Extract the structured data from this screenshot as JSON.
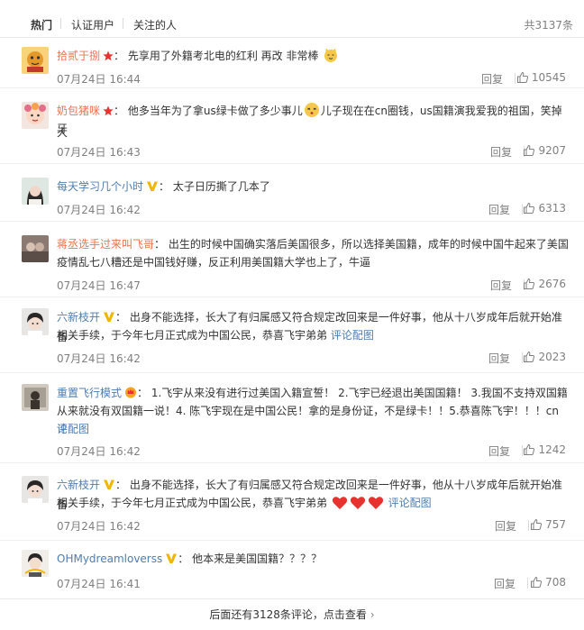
{
  "tabs": {
    "hot": "热门",
    "verified": "认证用户",
    "following": "关注的人",
    "total": "共3137条"
  },
  "comments": [
    {
      "username": "拾贰于捌",
      "badge": "star",
      "colon": "：",
      "text": "先享用了外籍考北电的红利 再改 非常棒",
      "emoji": "cat-face",
      "time": "07月24日 16:44",
      "reply": "回复",
      "likes": "10545"
    },
    {
      "username": "奶包猪咪",
      "badge": "star",
      "colon": "：",
      "text_a": "他多当年为了拿us绿卡做了多少事儿",
      "emoji": "dizzy-face",
      "text_b": "儿子现在在cn圈钱，us国籍演我爱我的祖国，笑掉大",
      "text_c": "牙",
      "time": "07月24日 16:43",
      "reply": "回复",
      "likes": "9207"
    },
    {
      "username": "每天学习几个小时",
      "badge": "v-yellow",
      "colon": "：",
      "text": "太子日历撕了几本了",
      "time": "07月24日 16:42",
      "reply": "回复",
      "likes": "6313"
    },
    {
      "username": "蒋丞选手过来叫飞哥",
      "colon": "：",
      "text_a": "出生的时候中国确实落后美国很多，所以选择美国籍，成年的时候中国牛起来了美国",
      "text_b": "疫情乱七八糟还是中国钱好赚，反正利用美国籍大学也上了，牛逼",
      "time": "07月24日 16:47",
      "reply": "回复",
      "likes": "2676"
    },
    {
      "username": "六新枝开",
      "badge": "v-yellow",
      "colon": "：",
      "text_a": "出身不能选择，长大了有归属感又符合规定改回来是一件好事，他从十八岁成年后就开始准备",
      "text_b": "相关手续，于今年七月正式成为中国公民，恭喜飞宇弟弟",
      "link": "评论配图",
      "time": "07月24日 16:42",
      "reply": "回复",
      "likes": "2023"
    },
    {
      "username": "重置飞行模式",
      "badge": "crown",
      "colon": "：",
      "text_a": "1.飞宇从来没有进行过美国入籍宣誓！ 2.飞宇已经退出美国国籍！ 3.我国不支持双国籍",
      "text_b": "从来就没有双国籍一说！4. 陈飞宇现在是中国公民！拿的是身份证，不是绿卡！！5.恭喜陈飞宇！！！cn",
      "link_a": "评",
      "link_b": "论配图",
      "time": "07月24日 16:42",
      "reply": "回复",
      "likes": "1242"
    },
    {
      "username": "六新枝开",
      "badge": "v-yellow",
      "colon": "：",
      "text_a": "出身不能选择，长大了有归属感又符合规定改回来是一件好事，他从十八岁成年后就开始准备",
      "text_b": "相关手续，于今年七月正式成为中国公民，恭喜飞宇弟弟",
      "emoji": "hearts",
      "link": "评论配图",
      "time": "07月24日 16:42",
      "reply": "回复",
      "likes": "757"
    },
    {
      "username": "OHMydreamloverss",
      "badge": "v-yellow",
      "colon": "：",
      "text": "他本来是美国国籍？？？？",
      "time": "07月24日 16:41",
      "reply": "回复",
      "likes": "708"
    }
  ],
  "more": {
    "label": "后面还有3128条评论，点击查看",
    "chevron": "›"
  },
  "colors": {
    "username_orange": "#eb7350",
    "link_blue": "#507daf",
    "muted_gray": "#808080",
    "heart_red": "#e8322f",
    "vip_gold": "#f2b600"
  }
}
